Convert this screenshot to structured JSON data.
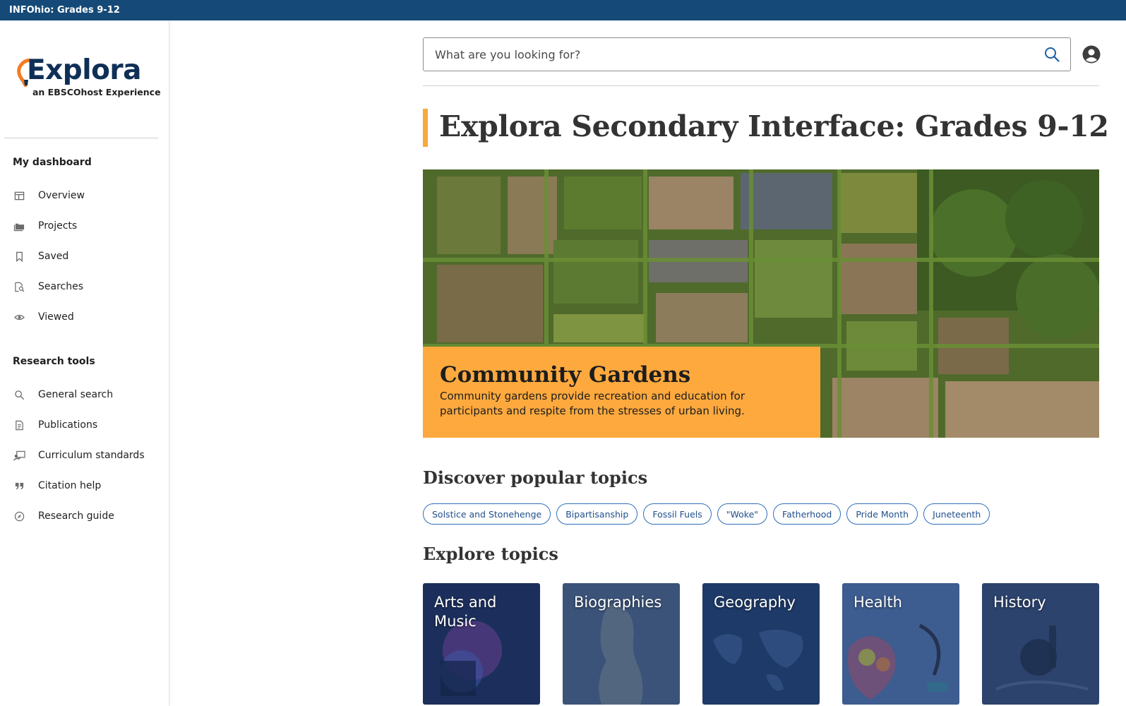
{
  "topbar": {
    "title": "INFOhio: Grades 9-12"
  },
  "brand": {
    "name": "Explora",
    "tagline": "an EBSCOhost Experience",
    "accent_color": "#f47b20",
    "primary_color": "#0f2f57"
  },
  "sidebar": {
    "sections": [
      {
        "title": "My dashboard",
        "items": [
          {
            "label": "Overview",
            "icon": "overview-icon"
          },
          {
            "label": "Projects",
            "icon": "folder-icon"
          },
          {
            "label": "Saved",
            "icon": "bookmark-icon"
          },
          {
            "label": "Searches",
            "icon": "search-history-icon"
          },
          {
            "label": "Viewed",
            "icon": "eye-icon"
          }
        ]
      },
      {
        "title": "Research tools",
        "items": [
          {
            "label": "General search",
            "icon": "search-icon"
          },
          {
            "label": "Publications",
            "icon": "document-icon"
          },
          {
            "label": "Curriculum standards",
            "icon": "teacher-icon"
          },
          {
            "label": "Citation help",
            "icon": "quote-icon"
          },
          {
            "label": "Research guide",
            "icon": "compass-icon"
          }
        ]
      }
    ]
  },
  "search": {
    "placeholder": "What are you looking for?",
    "value": ""
  },
  "page": {
    "title": "Explora Secondary Interface: Grades 9-12",
    "accent_color": "#f7a93b"
  },
  "hero": {
    "title": "Community Gardens",
    "description": "Community gardens provide recreation and education for participants and respite from the stresses of urban living.",
    "card_color": "#fda93e"
  },
  "popular": {
    "heading": "Discover popular topics",
    "topics": [
      "Solstice and Stonehenge",
      "Bipartisanship",
      "Fossil Fuels",
      "\"Woke\"",
      "Fatherhood",
      "Pride Month",
      "Juneteenth"
    ]
  },
  "explore": {
    "heading": "Explore topics",
    "topics": [
      {
        "label": "Arts and Music",
        "color": "#1c2f5c"
      },
      {
        "label": "Biographies",
        "color": "#3b5379"
      },
      {
        "label": "Geography",
        "color": "#1e3a68"
      },
      {
        "label": "Health",
        "color": "#3d5c8f"
      },
      {
        "label": "History",
        "color": "#2c436d"
      }
    ]
  }
}
